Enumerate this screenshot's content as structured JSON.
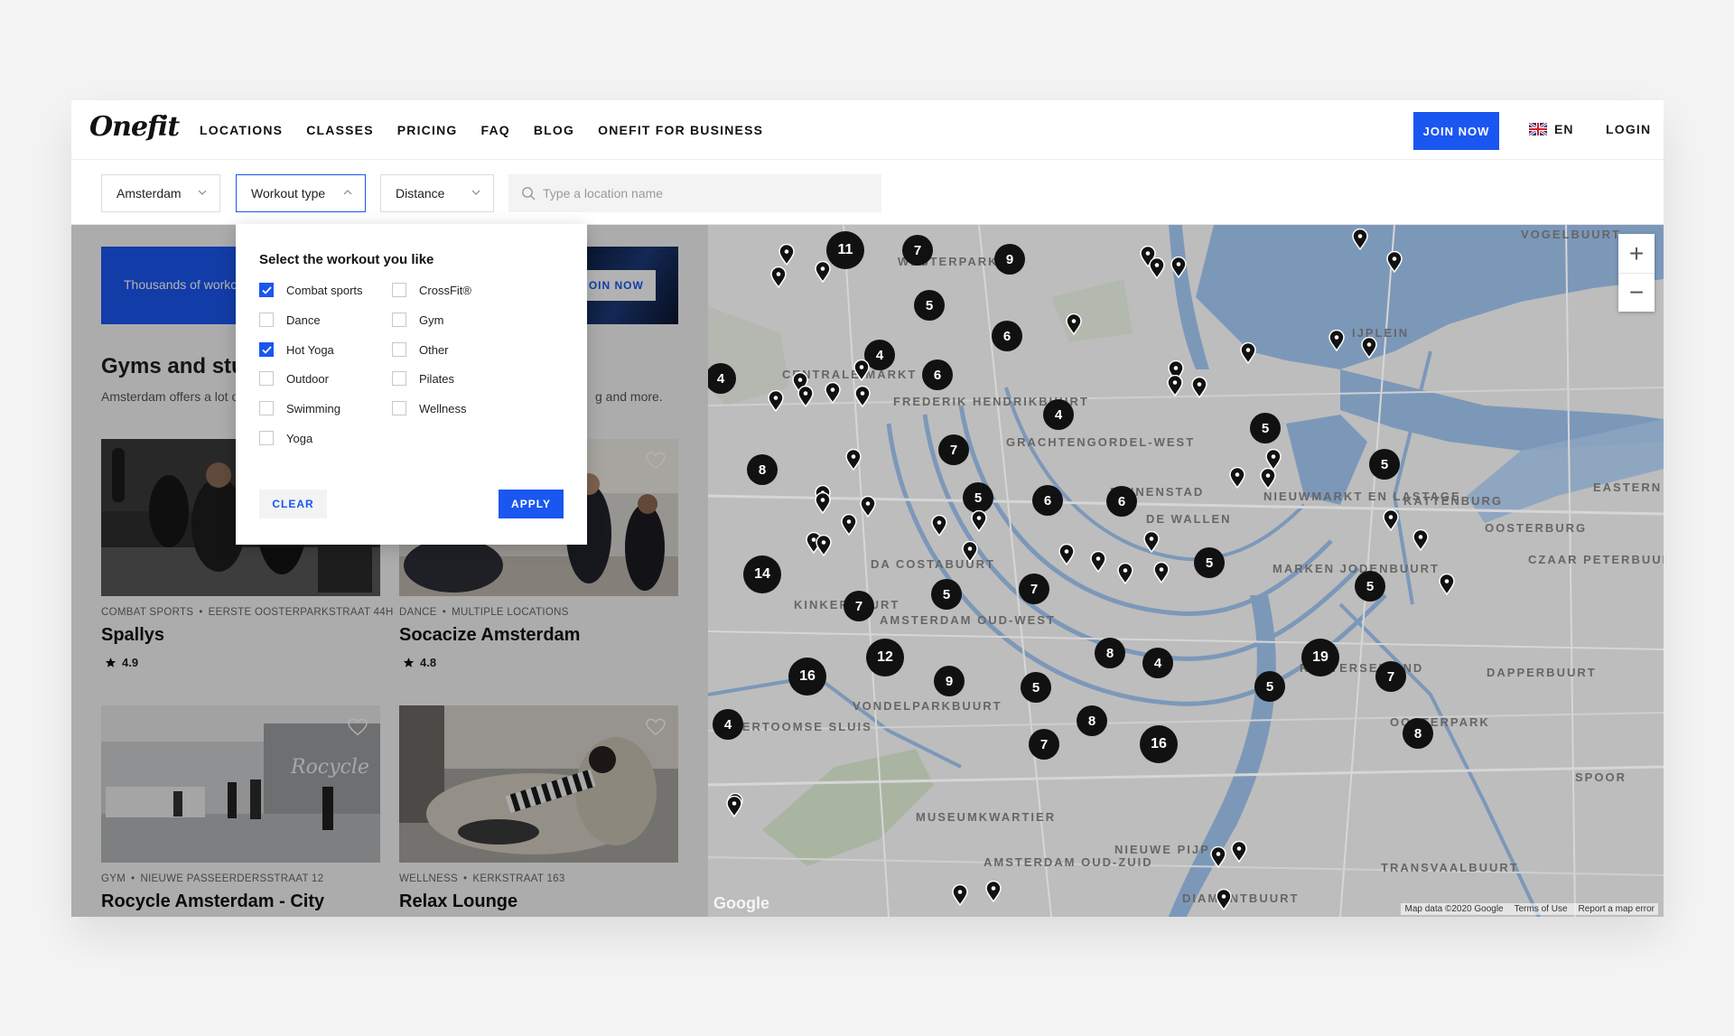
{
  "brand": {
    "logo_text": "Onefit"
  },
  "nav": {
    "links": [
      "LOCATIONS",
      "CLASSES",
      "PRICING",
      "FAQ",
      "BLOG",
      "ONEFIT FOR BUSINESS"
    ],
    "join_label": "JOIN NOW",
    "language": "EN",
    "login_label": "LOGIN"
  },
  "filters": {
    "city": "Amsterdam",
    "workout_type": "Workout type",
    "distance": "Distance",
    "search_placeholder": "Type a location name"
  },
  "workout_dropdown": {
    "title": "Select the workout you like",
    "options": [
      {
        "label": "Combat sports",
        "checked": true
      },
      {
        "label": "Dance",
        "checked": false
      },
      {
        "label": "Hot Yoga",
        "checked": true
      },
      {
        "label": "Outdoor",
        "checked": false
      },
      {
        "label": "Swimming",
        "checked": false
      },
      {
        "label": "Yoga",
        "checked": false
      },
      {
        "label": "CrossFit®",
        "checked": false
      },
      {
        "label": "Gym",
        "checked": false
      },
      {
        "label": "Other",
        "checked": false
      },
      {
        "label": "Pilates",
        "checked": false
      },
      {
        "label": "Wellness",
        "checked": false
      }
    ],
    "clear_label": "CLEAR",
    "apply_label": "APPLY"
  },
  "banner": {
    "text": "Thousands of worko",
    "button_label": "JOIN NOW"
  },
  "listing": {
    "title": "Gyms and stuc",
    "description_left": "Amsterdam offers a lot o",
    "description_right": "g and more."
  },
  "cards": [
    {
      "category": "COMBAT SPORTS",
      "location": "EERSTE OOSTERPARKSTRAAT 44H",
      "name": "Spallys",
      "rating": "4.9"
    },
    {
      "category": "DANCE",
      "location": "MULTIPLE LOCATIONS",
      "name": "Socacize Amsterdam",
      "rating": "4.8"
    },
    {
      "category": "GYM",
      "location": "NIEUWE PASSEERDERSSTRAAT 12",
      "name": "Rocycle Amsterdam - City",
      "rating": ""
    },
    {
      "category": "WELLNESS",
      "location": "KERKSTRAAT 163",
      "name": "Relax Lounge",
      "rating": ""
    }
  ],
  "map": {
    "clusters": [
      "11",
      "7",
      "9",
      "5",
      "6",
      "4",
      "6",
      "4",
      "4",
      "7",
      "8",
      "5",
      "6",
      "6",
      "5",
      "5",
      "5",
      "14",
      "7",
      "5",
      "7",
      "12",
      "16",
      "8",
      "4",
      "19",
      "7",
      "9",
      "5",
      "8",
      "16",
      "7",
      "4",
      "8",
      "5",
      "5"
    ],
    "district_labels": [
      "VOGELBUURT",
      "WESTERPARK",
      "IJPLEIN",
      "CENTRALE MARKT",
      "FREDERIK HENDRIKBUURT",
      "GRACHTENGORDEL-WEST",
      "BINNENSTAD",
      "DE WALLEN",
      "NIEUWMARKT EN LASTAGE",
      "KATTENBURG",
      "OOSTERBURG",
      "CZAAR PETERBUURT",
      "EASTERN DOCKLANDS",
      "DA COSTABUURT",
      "KINKERBUURT",
      "MARKEN JODENBUURT",
      "ROETERSEILAND",
      "DAPPERBUURT",
      "OOSTERPARK",
      "AMSTERDAM OUD-WEST",
      "VONDELPARKBUURT",
      "OVERTOOMSE SLUIS",
      "MUSEUMKWARTIER",
      "AMSTERDAM OUD-ZUID",
      "NIEUWE PIJP",
      "DIAMANTBUURT",
      "TRANSVAALBUURT",
      "SPOOR"
    ],
    "attribution": "Map data ©2020 Google",
    "terms": "Terms of Use",
    "report": "Report a map error",
    "google_label": "Google"
  },
  "colors": {
    "accent": "#1a56f0",
    "marker": "#111111",
    "map_base": "#b9b9b9",
    "water": "#7c98b9"
  }
}
